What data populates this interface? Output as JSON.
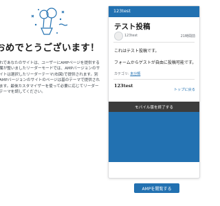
{
  "welcome": {
    "title": "おめでとうございます！",
    "body": "れであなたのサイトは、ユーザーにAMPページを提供する備が整いましたリーダーモードでは、AMPバージョンのサイトは選択したリーダーテーマ(右図)で提供されます。別AMPバージョンのサイトのページは基のテーマで提供されます。最後カスタマイザーを使って必要に応じてリーダーテーマを調してください。"
  },
  "preview": {
    "site_name": "123test",
    "post_title": "テスト投稿",
    "author": "123test",
    "time": "21時間前",
    "para1": "これはテスト投稿です。",
    "para2": "フォームからゲストが自由に投稿可能です。",
    "category_label": "カテゴリ: ",
    "category_link": "未分類",
    "footer_site": "123test",
    "back_to_top": "トップに戻る",
    "exit_mobile": "モバイル版を終了する",
    "header_color": "#2271b1"
  },
  "actions": {
    "browse_amp": "AMPを閲覧する"
  }
}
